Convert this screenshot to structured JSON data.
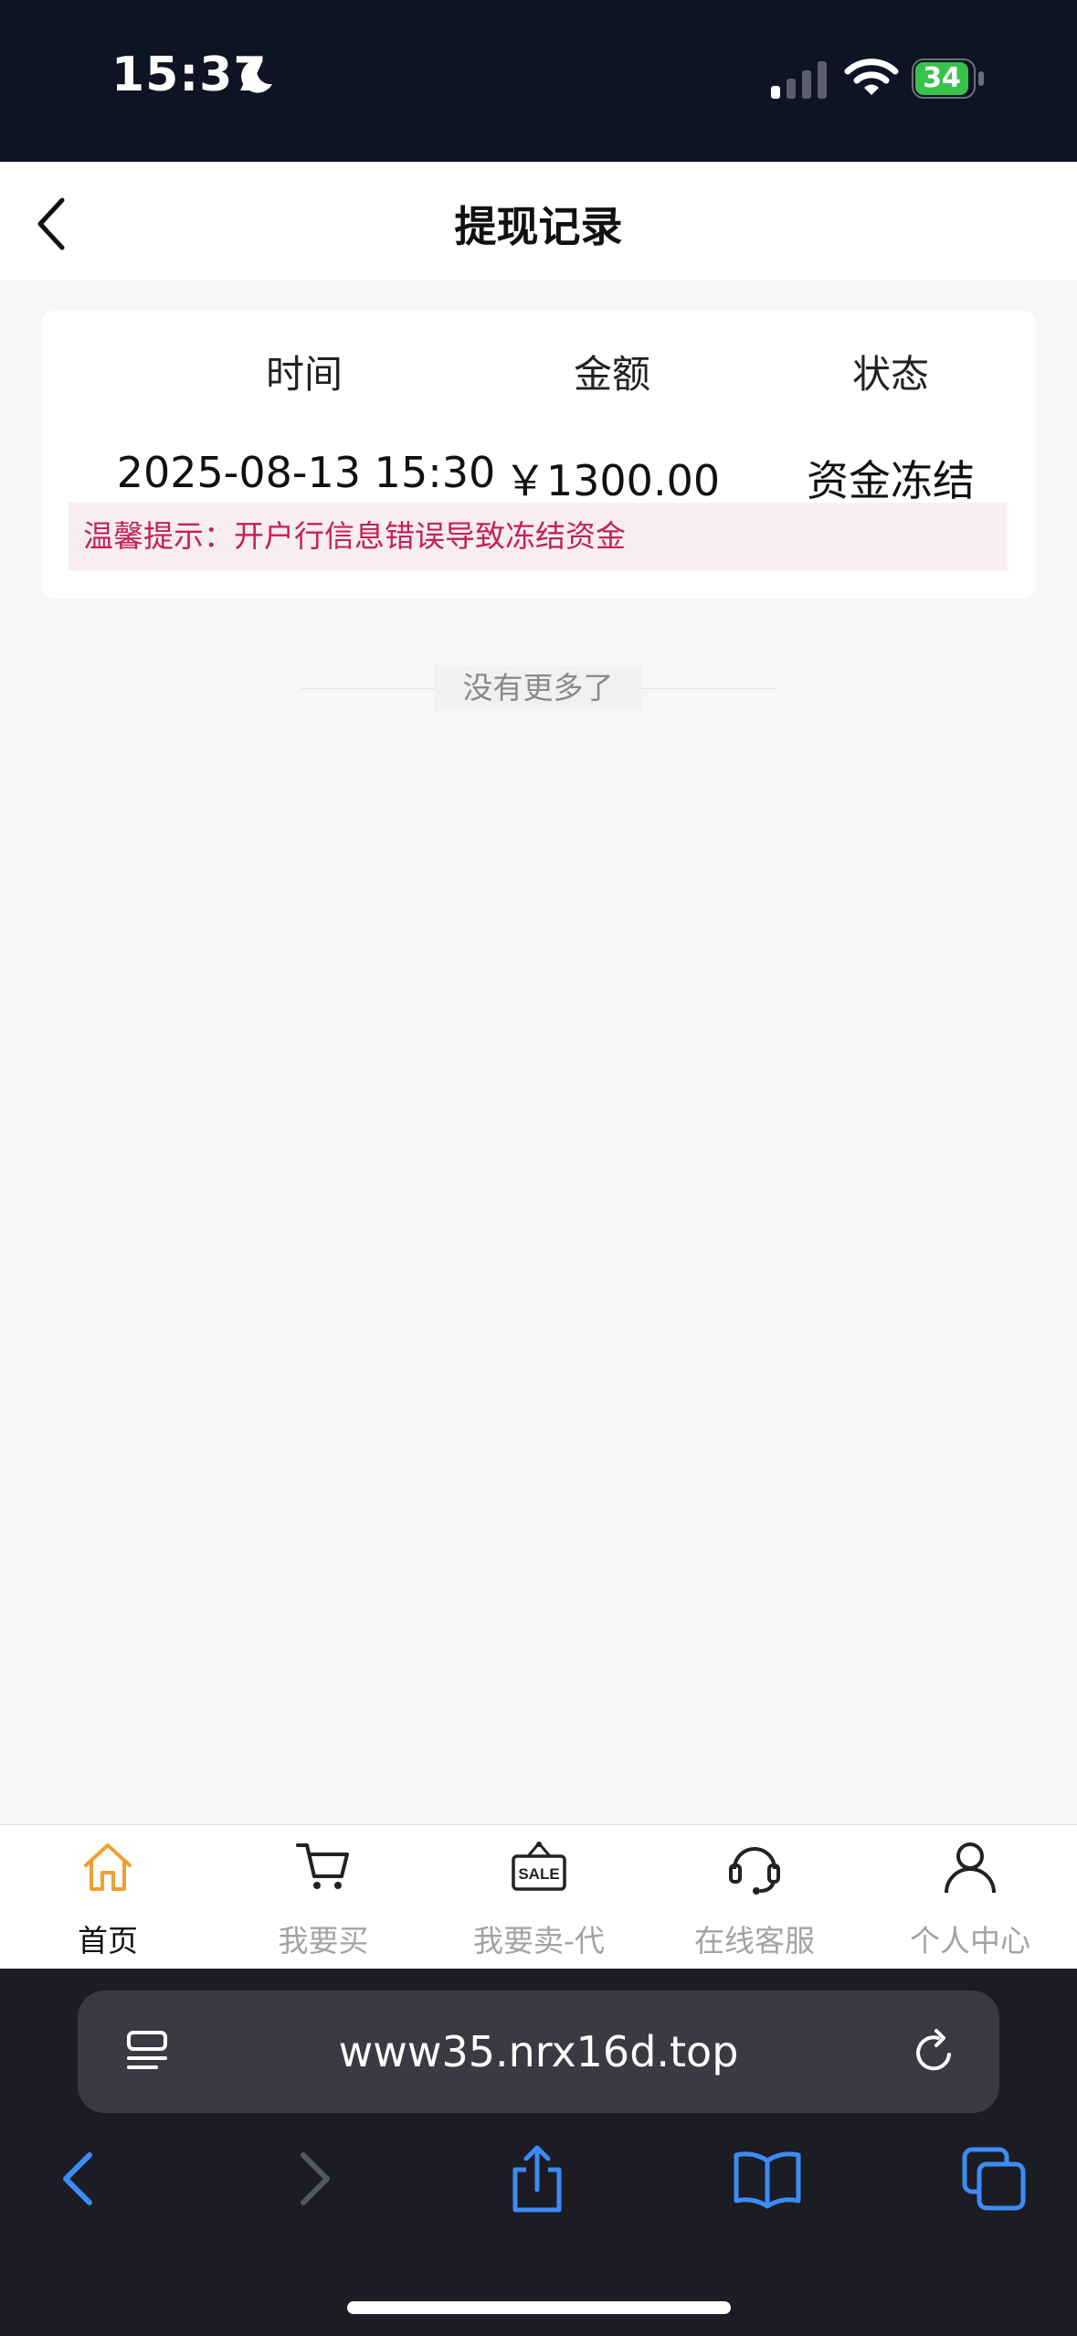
{
  "status_bar": {
    "time": "15:37",
    "battery": "34"
  },
  "header": {
    "title": "提现记录"
  },
  "table": {
    "columns": [
      "时间",
      "金额",
      "状态"
    ],
    "rows": [
      {
        "time": "2025-08-13 15:30",
        "amount": "￥1300.00",
        "status": "资金冻结",
        "tip": "温馨提示：开户行信息错误导致冻结资金"
      }
    ]
  },
  "no_more": "没有更多了",
  "tabbar": {
    "items": [
      {
        "label": "首页",
        "icon": "home-icon",
        "active": true
      },
      {
        "label": "我要买",
        "icon": "cart-icon"
      },
      {
        "label": "我要卖-代",
        "icon": "sale-sign-icon"
      },
      {
        "label": "在线客服",
        "icon": "headset-icon"
      },
      {
        "label": "个人中心",
        "icon": "user-icon"
      }
    ],
    "active_color": "#f0a030"
  },
  "browser": {
    "url": "www35.nrx16d.top"
  }
}
